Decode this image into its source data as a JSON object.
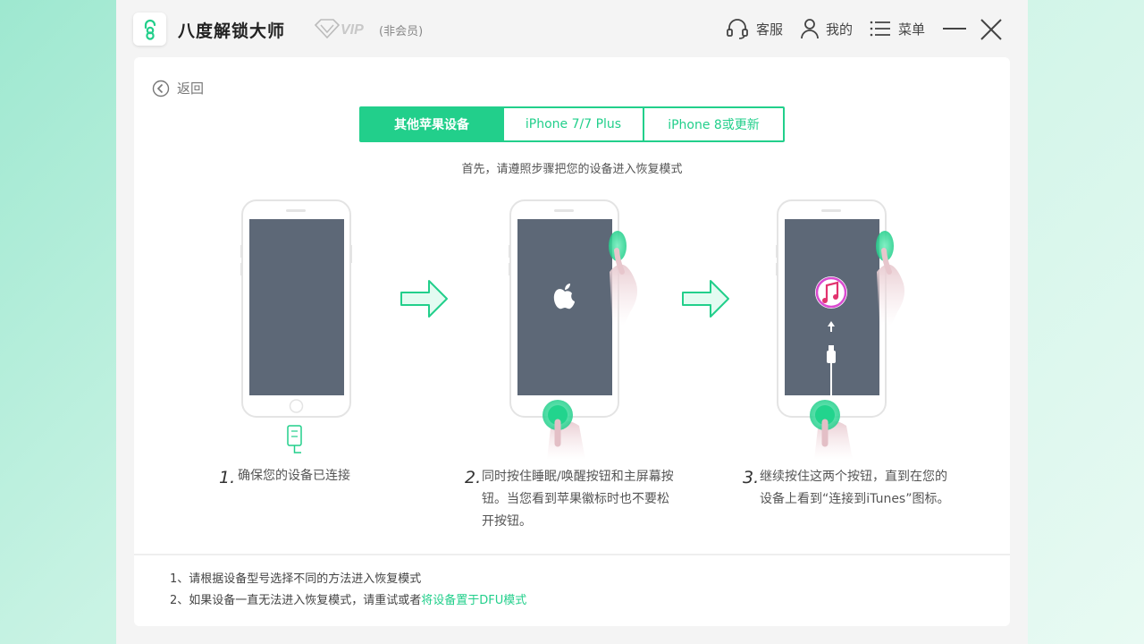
{
  "app": {
    "name": "八度解锁大师",
    "vip_label": "VIP",
    "vip_status": "(非会员)"
  },
  "header": {
    "service_label": "客服",
    "account_label": "我的",
    "menu_label": "菜单"
  },
  "back_label": "返回",
  "tabs": [
    {
      "label": "其他苹果设备",
      "active": true
    },
    {
      "label": "iPhone 7/7 Plus",
      "active": false
    },
    {
      "label": "iPhone 8或更新",
      "active": false
    }
  ],
  "instruction": "首先，请遵照步骤把您的设备进入恢复模式",
  "steps": [
    {
      "num": "1.",
      "line1": "确保您的设备已连接",
      "line2": "",
      "line3": ""
    },
    {
      "num": "2.",
      "line1": "同时按住睡眠/唤醒按钮和主屏幕按",
      "line2": "钮。当您看到苹果徽标时也不要松",
      "line3": "开按钮。"
    },
    {
      "num": "3.",
      "line1": "继续按住这两个按钮，直到在您的",
      "line2": "设备上看到“连接到iTunes”图标。",
      "line3": ""
    }
  ],
  "notes": {
    "note1": "1、请根据设备型号选择不同的方法进入恢复模式",
    "note2_prefix": "2、如果设备一直无法进入恢复模式，请重试或者",
    "note2_link": "将设备置于DFU模式"
  },
  "colors": {
    "accent": "#22cf8b",
    "screen": "#5d6877"
  }
}
